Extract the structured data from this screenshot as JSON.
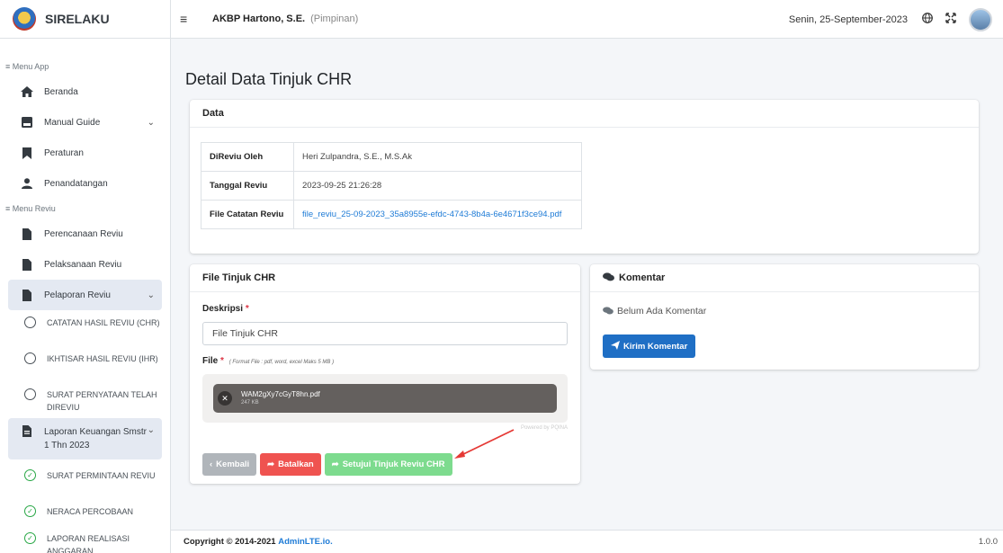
{
  "app": {
    "brand": "SIRELAKU"
  },
  "topbar": {
    "user_name": "AKBP Hartono, S.E.",
    "user_role": "(Pimpinan)",
    "date": "Senin, 25-September-2023",
    "icons": [
      "menu-icon",
      "globe-icon",
      "fullscreen-icon",
      "avatar"
    ]
  },
  "sidebar": {
    "header_app": "≡ Menu App",
    "header_reviu": "≡ Menu Reviu",
    "items": [
      {
        "label": "Beranda",
        "icon": "home-icon"
      },
      {
        "label": "Manual Guide",
        "icon": "book-icon"
      },
      {
        "label": "Peraturan",
        "icon": "bookmark-icon"
      },
      {
        "label": "Penandatangan",
        "icon": "user-icon"
      },
      {
        "label": "Perencanaan Reviu",
        "icon": "file-icon"
      },
      {
        "label": "Pelaksanaan Reviu",
        "icon": "file-icon"
      },
      {
        "label": "Pelaporan Reviu",
        "icon": "file-icon"
      },
      {
        "label": "Laporan Keuangan Smstr 1 Thn 2023",
        "icon": "file-icon"
      }
    ],
    "sub_pelaporan": [
      "CATATAN HASIL REVIU (CHR)",
      "IKHTISAR HASIL REVIU (IHR)",
      "SURAT PERNYATAAN TELAH DIREVIU"
    ],
    "sub_laporan": [
      "SURAT PERMINTAAN REVIU",
      "NERACA PERCOBAAN",
      "LAPORAN REALISASI ANGGARAN"
    ]
  },
  "main": {
    "title": "Detail Data Tinjuk CHR",
    "data_card": {
      "header": "Data",
      "rows": [
        {
          "key": "DiReviu Oleh",
          "value": "Heri Zulpandra, S.E., M.S.Ak"
        },
        {
          "key": "Tanggal Reviu",
          "value": "2023-09-25 21:26:28"
        },
        {
          "key": "File Catatan Reviu",
          "value": "file_reviu_25-09-2023_35a8955e-efdc-4743-8b4a-6e4671f3ce94.pdf"
        }
      ]
    },
    "file_card": {
      "header": "File Tinjuk CHR",
      "deskripsi_label": "Deskripsi",
      "required_mark": "*",
      "deskripsi_value": "File Tinjuk CHR",
      "file_label": "File",
      "file_hint": "( Format File : pdf, word, excel Maks 5 MB )",
      "upload_name": "WAM2gXy7cGyT8hn.pdf",
      "upload_size": "247 KB",
      "powered_by": "Powered by PQINA",
      "btn_back": "Kembali",
      "btn_cancel": "Batalkan",
      "btn_approve": "Setujui Tinjuk Reviu CHR"
    },
    "comment_card": {
      "header": "Komentar",
      "empty_text": "Belum Ada Komentar",
      "btn_send": "Kirim Komentar"
    }
  },
  "footer": {
    "copyright": "Copyright © 2014-2021",
    "link": "AdminLTE.io.",
    "version": "1.0.0"
  },
  "colors": {
    "accent_blue": "#1f6fc5",
    "danger": "#ef5350",
    "success_light": "#7ddb8e",
    "annotation_arrow": "#e53935"
  }
}
